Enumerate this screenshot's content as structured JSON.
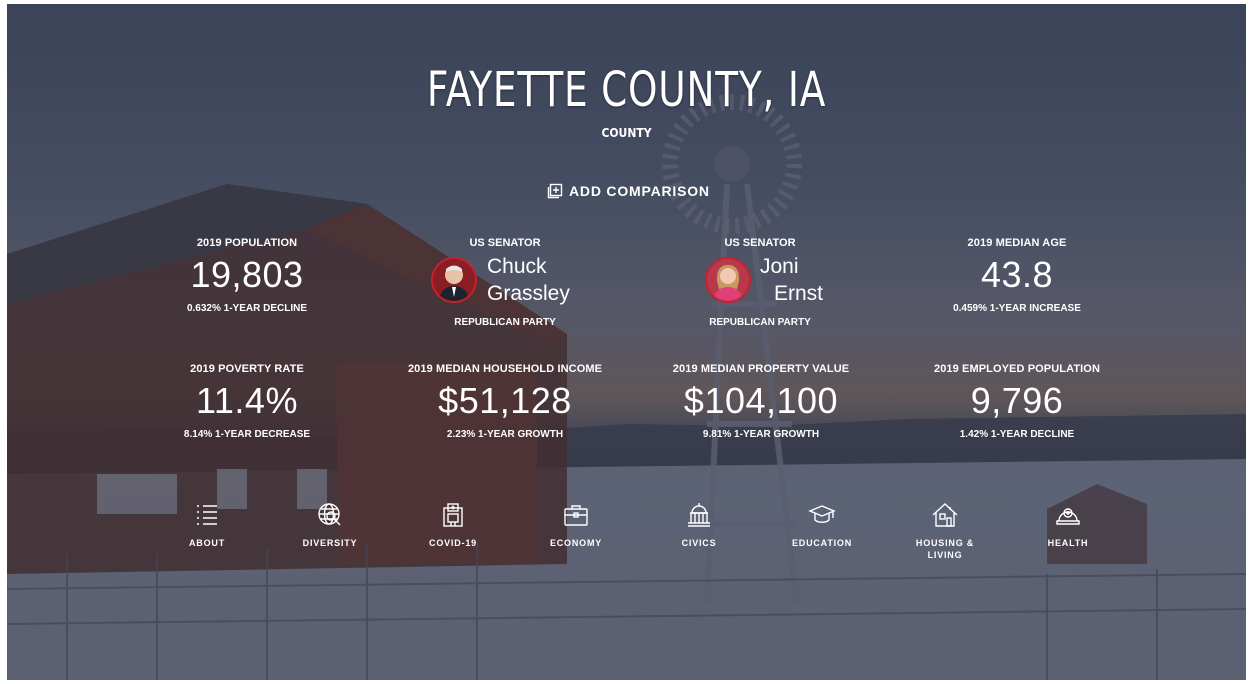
{
  "header": {
    "title": "FAYETTE COUNTY, IA",
    "subtitle": "COUNTY",
    "add_comparison": "ADD COMPARISON"
  },
  "stats": [
    {
      "label": "2019 POPULATION",
      "value": "19,803",
      "change": "0.632% 1-YEAR DECLINE"
    },
    {
      "label": "2019 MEDIAN AGE",
      "value": "43.8",
      "change": "0.459% 1-YEAR INCREASE"
    },
    {
      "label": "2019 POVERTY RATE",
      "value": "11.4%",
      "change": "8.14% 1-YEAR DECREASE"
    },
    {
      "label": "2019 MEDIAN HOUSEHOLD INCOME",
      "value": "$51,128",
      "change": "2.23% 1-YEAR GROWTH"
    },
    {
      "label": "2019 MEDIAN PROPERTY VALUE",
      "value": "$104,100",
      "change": "9.81% 1-YEAR GROWTH"
    },
    {
      "label": "2019 EMPLOYED POPULATION",
      "value": "9,796",
      "change": "1.42% 1-YEAR DECLINE"
    }
  ],
  "senators": [
    {
      "label": "US SENATOR",
      "first": "Chuck",
      "last": "Grassley",
      "party": "REPUBLICAN PARTY"
    },
    {
      "label": "US SENATOR",
      "first": "Joni",
      "last": "Ernst",
      "party": "REPUBLICAN PARTY"
    }
  ],
  "nav": [
    {
      "label": "ABOUT",
      "icon": "list-icon"
    },
    {
      "label": "DIVERSITY",
      "icon": "globe-search-icon"
    },
    {
      "label": "COVID-19",
      "icon": "hospital-icon"
    },
    {
      "label": "ECONOMY",
      "icon": "briefcase-icon"
    },
    {
      "label": "CIVICS",
      "icon": "capitol-icon"
    },
    {
      "label": "EDUCATION",
      "icon": "graduation-cap-icon"
    },
    {
      "label": "HOUSING &\nLIVING",
      "icon": "house-icon"
    },
    {
      "label": "HEALTH",
      "icon": "helmet-icon"
    }
  ],
  "colors": {
    "senator_ring": "#c8202c",
    "text": "#ffffff"
  }
}
